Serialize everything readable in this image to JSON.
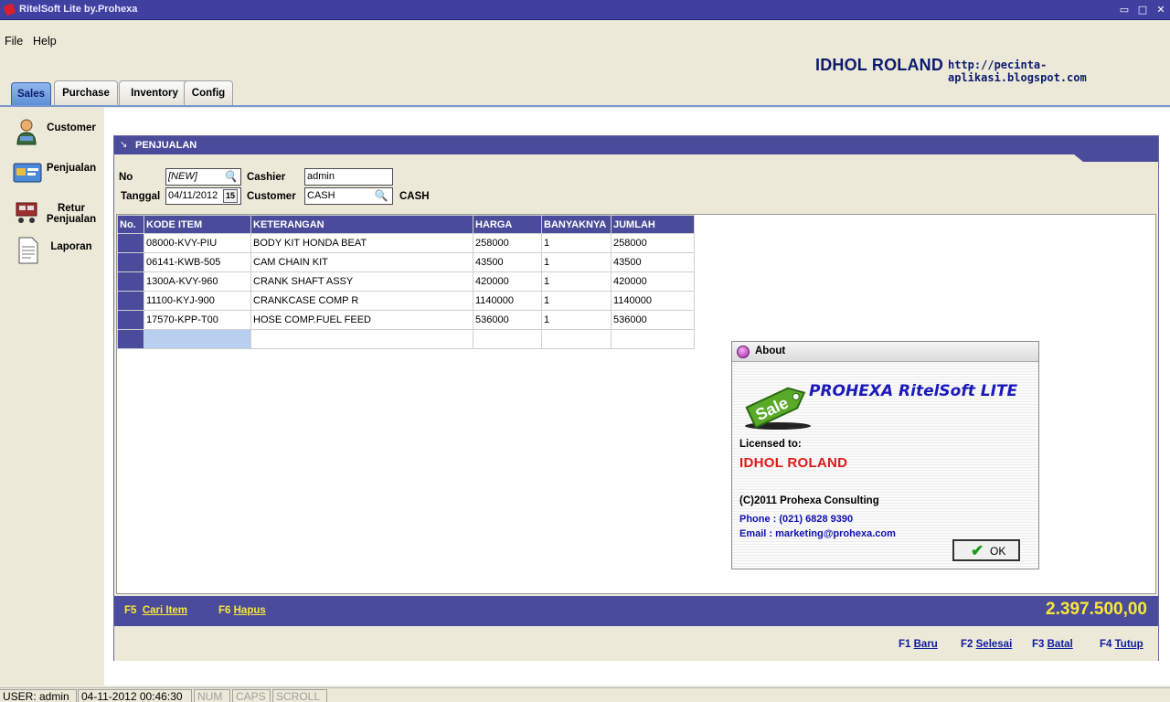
{
  "window": {
    "title": "RitelSoft Lite by.Prohexa",
    "min": "▭",
    "max": "□",
    "close": "✕"
  },
  "menu": {
    "file": "File",
    "help": "Help"
  },
  "header": {
    "user": "IDHOL ROLAND",
    "url": "http://pecinta-aplikasi.blogspot.com"
  },
  "tabs": [
    {
      "label": "Sales"
    },
    {
      "label": "Purchase"
    },
    {
      "label": "Inventory"
    },
    {
      "label": "Config"
    }
  ],
  "nav": [
    {
      "label": "Customer",
      "icon": "customer-icon"
    },
    {
      "label": "Penjualan",
      "icon": "sales-card-icon"
    },
    {
      "label": "Retur Penjualan",
      "icon": "return-cart-icon"
    },
    {
      "label": "Laporan",
      "icon": "report-document-icon"
    }
  ],
  "panel": {
    "title": "PENJUALAN",
    "no_label": "No",
    "no_value": "[NEW]",
    "tanggal_label": "Tanggal",
    "tanggal_value": "04/11/2012",
    "cal_label": "15",
    "cashier_label": "Cashier",
    "cashier_value": "admin",
    "customer_label": "Customer",
    "customer_value": "CASH",
    "customer_name": "CASH"
  },
  "grid": {
    "columns": [
      "No.",
      "KODE ITEM",
      "KETERANGAN",
      "HARGA",
      "BANYAKNYA",
      "JUMLAH"
    ],
    "rows": [
      [
        "",
        "08000-KVY-PIU",
        "BODY KIT HONDA BEAT",
        "258000",
        "1",
        "258000"
      ],
      [
        "",
        "06141-KWB-505",
        "CAM CHAIN KIT",
        "43500",
        "1",
        "43500"
      ],
      [
        "",
        "1300A-KVY-960",
        "CRANK SHAFT ASSY",
        "420000",
        "1",
        "420000"
      ],
      [
        "",
        "11100-KYJ-900",
        "CRANKCASE COMP R",
        "1140000",
        "1",
        "1140000"
      ],
      [
        "",
        "17570-KPP-T00",
        "HOSE COMP.FUEL FEED",
        "536000",
        "1",
        "536000"
      ]
    ]
  },
  "footer": {
    "f5": "F5",
    "f5_label": "Cari Item",
    "f6": "F6",
    "f6_label": "Hapus",
    "total": "2.397.500,00"
  },
  "actions": {
    "f1": "F1",
    "f1_label": "Baru",
    "f2": "F2",
    "f2_label": "Selesai",
    "f3": "F3",
    "f3_label": "Batal",
    "f4": "F4",
    "f4_label": "Tutup"
  },
  "about": {
    "title": "About",
    "product": "PROHEXA RitelSoft LITE",
    "sale_tag": "Sale",
    "licensed": "Licensed to:",
    "licensee": "IDHOL ROLAND",
    "copyright": "(C)2011 Prohexa Consulting",
    "phone": "Phone : (021) 6828 9390",
    "email": "Email   : marketing@prohexa.com",
    "ok": "OK"
  },
  "status": {
    "user": "USER: admin",
    "datetime": "04-11-2012 00:46:30",
    "num": "NUM",
    "caps": "CAPS",
    "scroll": "SCROLL"
  },
  "colors": {
    "accent": "#4b4b9b",
    "total": "#f8e838",
    "link": "#0c1a9e",
    "license_name": "#e01818"
  }
}
